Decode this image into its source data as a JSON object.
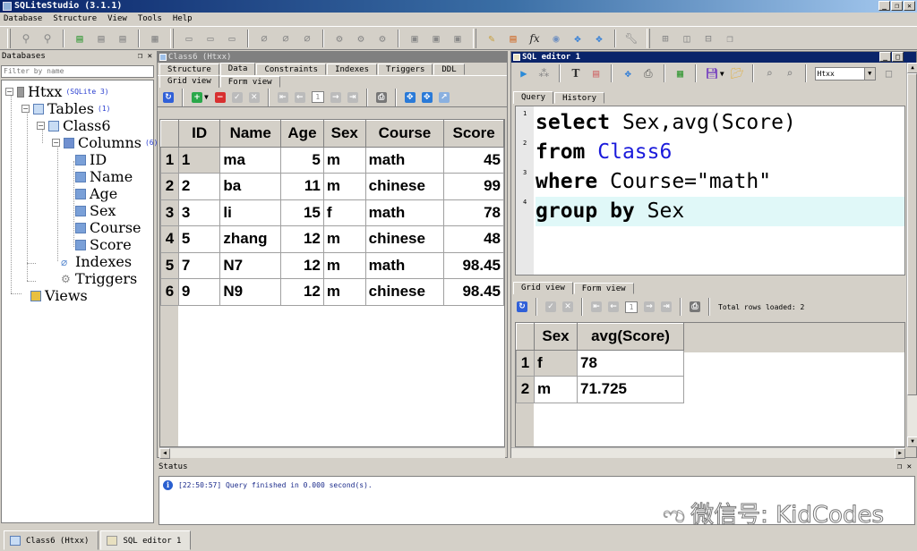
{
  "window": {
    "title": "SQLiteStudio (3.1.1)",
    "controls": [
      "_",
      "❐",
      "✕"
    ]
  },
  "menu": [
    "Database",
    "Structure",
    "View",
    "Tools",
    "Help"
  ],
  "toolbar": {
    "icons": [
      "connect-icon",
      "disconnect-icon",
      "add-database-icon",
      "edit-database-icon",
      "remove-database-icon",
      "refresh-schema-icon",
      "create-table-icon",
      "edit-table-icon",
      "delete-table-icon",
      "create-index-icon",
      "edit-index-icon",
      "delete-index-icon",
      "create-trigger-icon",
      "edit-trigger-icon",
      "delete-trigger-icon",
      "create-view-icon",
      "edit-view-icon",
      "delete-view-icon",
      "sql-editor-icon",
      "ddl-history-icon",
      "functions-icon",
      "collations-icon",
      "export-icon",
      "import-icon",
      "config-icon",
      "tile-icon",
      "tile-horizontal-icon",
      "tile-vertical-icon",
      "cascade-icon"
    ],
    "fx_label": "fx"
  },
  "databases_panel": {
    "title": "Databases",
    "filter_placeholder": "Filter by name",
    "tree": {
      "db": {
        "name": "Htxx",
        "badge": "(SQLite 3)"
      },
      "tables": {
        "name": "Tables",
        "badge": "(1)"
      },
      "table": {
        "name": "Class6"
      },
      "columns": {
        "name": "Columns",
        "badge": "(6)"
      },
      "column_items": [
        "ID",
        "Name",
        "Age",
        "Sex",
        "Course",
        "Score"
      ],
      "indexes": "Indexes",
      "triggers": "Triggers",
      "views": "Views"
    }
  },
  "table_window": {
    "title": "Class6 (Htxx)",
    "tabs": [
      "Structure",
      "Data",
      "Constraints",
      "Indexes",
      "Triggers",
      "DDL"
    ],
    "active_tab": "Data",
    "view_tabs": [
      "Grid view",
      "Form view"
    ],
    "page": "1",
    "grid": {
      "columns": [
        "ID",
        "Name",
        "Age",
        "Sex",
        "Course",
        "Score"
      ],
      "rows": [
        {
          "n": "1",
          "cells": [
            "1",
            "ma",
            "5",
            "m",
            "math",
            "45"
          ]
        },
        {
          "n": "2",
          "cells": [
            "2",
            "ba",
            "11",
            "m",
            "chinese",
            "99"
          ]
        },
        {
          "n": "3",
          "cells": [
            "3",
            "li",
            "15",
            "f",
            "math",
            "78"
          ]
        },
        {
          "n": "4",
          "cells": [
            "5",
            "zhang",
            "12",
            "m",
            "chinese",
            "48"
          ]
        },
        {
          "n": "5",
          "cells": [
            "7",
            "N7",
            "12",
            "m",
            "math",
            "98.45"
          ]
        },
        {
          "n": "6",
          "cells": [
            "9",
            "N9",
            "12",
            "m",
            "chinese",
            "98.45"
          ]
        }
      ]
    }
  },
  "sql_editor": {
    "title": "SQL editor 1",
    "database_select": "Htxx",
    "tabs": [
      "Query",
      "History"
    ],
    "active_tab": "Query",
    "lines": [
      {
        "n": "1",
        "kw": "select",
        "rest": " Sex,avg(Score)",
        "table": ""
      },
      {
        "n": "2",
        "kw": "from",
        "rest": " ",
        "table": "Class6"
      },
      {
        "n": "3",
        "kw": "where",
        "rest": " Course=\"math\"",
        "table": ""
      },
      {
        "n": "4",
        "kw": "group by",
        "rest": " Sex",
        "table": ""
      }
    ],
    "results": {
      "view_tabs": [
        "Grid view",
        "Form view"
      ],
      "page": "1",
      "rows_loaded": "Total rows loaded: 2",
      "columns": [
        "Sex",
        "avg(Score)"
      ],
      "rows": [
        {
          "n": "1",
          "cells": [
            "f",
            "78"
          ]
        },
        {
          "n": "2",
          "cells": [
            "m",
            "71.725"
          ]
        }
      ]
    }
  },
  "status": {
    "title": "Status",
    "message": "[22:50:57] Query finished in 0.000 second(s).",
    "watermark": "微信号: KidCodes"
  },
  "taskbar": [
    "Class6 (Htxx)",
    "SQL editor 1"
  ]
}
